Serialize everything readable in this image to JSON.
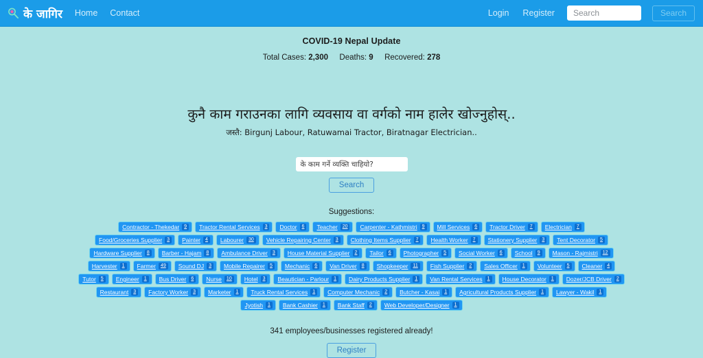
{
  "navbar": {
    "brand_icon": "magnifier-icon",
    "brand_text": "के जागिर",
    "links": [
      {
        "label": "Home"
      },
      {
        "label": "Contact"
      }
    ],
    "login_label": "Login",
    "register_label": "Register",
    "search_placeholder": "Search",
    "search_value": "",
    "search_button_label": "Search",
    "bg_color": "#1b9ce8"
  },
  "covid": {
    "title": "COVID-19 Nepal Update",
    "total_cases_label": "Total Cases:",
    "total_cases_value": "2,300",
    "deaths_label": "Deaths:",
    "deaths_value": "9",
    "recovered_label": "Recovered:",
    "recovered_value": "278"
  },
  "hero": {
    "heading": "कुनै काम गराउनका लागि व्यवसाय वा वर्गको नाम हालेर खोज्नुहोस्..",
    "subheading": "जस्तै: Birgunj Labour, Ratuwamai Tractor, Biratnagar Electrician.."
  },
  "search": {
    "placeholder": "के काम गर्ने व्यक्ति चाहियो?",
    "value": "",
    "button_label": "Search"
  },
  "suggestions": {
    "label": "Suggestions:",
    "tags": [
      {
        "label": "Contractor - Thekedar",
        "count": "9"
      },
      {
        "label": "Tractor Rental Services",
        "count": "3"
      },
      {
        "label": "Doctor",
        "count": "6"
      },
      {
        "label": "Teacher",
        "count": "20"
      },
      {
        "label": "Carpenter - Kathmistri",
        "count": "9"
      },
      {
        "label": "Mill Services",
        "count": "6"
      },
      {
        "label": "Tractor Driver",
        "count": "7"
      },
      {
        "label": "Electrician",
        "count": "7"
      },
      {
        "label": "Food/Groceries Supplier",
        "count": "3"
      },
      {
        "label": "Painter",
        "count": "4"
      },
      {
        "label": "Labourer",
        "count": "30"
      },
      {
        "label": "Vehicle Repairing Center",
        "count": "3"
      },
      {
        "label": "Clothing Items Supplier",
        "count": "7"
      },
      {
        "label": "Health Worker",
        "count": "7"
      },
      {
        "label": "Stationery Supplier",
        "count": "3"
      },
      {
        "label": "Tent Decorator",
        "count": "5"
      },
      {
        "label": "Hardware Supplier",
        "count": "8"
      },
      {
        "label": "Barber - Hajam",
        "count": "8"
      },
      {
        "label": "Ambulance Driver",
        "count": "3"
      },
      {
        "label": "House Material Supplier",
        "count": "2"
      },
      {
        "label": "Tailor",
        "count": "6"
      },
      {
        "label": "Photographer",
        "count": "5"
      },
      {
        "label": "Social Worker",
        "count": "6"
      },
      {
        "label": "School",
        "count": "9"
      },
      {
        "label": "Mason - Rajmistri",
        "count": "12"
      },
      {
        "label": "Harvester",
        "count": "1"
      },
      {
        "label": "Farmer",
        "count": "49"
      },
      {
        "label": "Sound DJ",
        "count": "3"
      },
      {
        "label": "Mobile Repairer",
        "count": "5"
      },
      {
        "label": "Mechanic",
        "count": "6"
      },
      {
        "label": "Van Driver",
        "count": "8"
      },
      {
        "label": "Shopkeeper",
        "count": "11"
      },
      {
        "label": "Fish Supplier",
        "count": "2"
      },
      {
        "label": "Sales Officer",
        "count": "1"
      },
      {
        "label": "Volunteer",
        "count": "5"
      },
      {
        "label": "Cleaner",
        "count": "4"
      },
      {
        "label": "Tutor",
        "count": "5"
      },
      {
        "label": "Engineer",
        "count": "1"
      },
      {
        "label": "Bus Driver",
        "count": "6"
      },
      {
        "label": "Nurse",
        "count": "10"
      },
      {
        "label": "Hotel",
        "count": "3"
      },
      {
        "label": "Beautician - Parlour",
        "count": "1"
      },
      {
        "label": "Dairy Products Supplier",
        "count": "1"
      },
      {
        "label": "Van Rental Services",
        "count": "1"
      },
      {
        "label": "House Decorator",
        "count": "1"
      },
      {
        "label": "Dozer/JCB Driver",
        "count": "2"
      },
      {
        "label": "Restaurant",
        "count": "3"
      },
      {
        "label": "Factory Worker",
        "count": "3"
      },
      {
        "label": "Marketer",
        "count": "1"
      },
      {
        "label": "Truck Rental Services",
        "count": "1"
      },
      {
        "label": "Computer Mechanic",
        "count": "2"
      },
      {
        "label": "Butcher - Kasai",
        "count": "1"
      },
      {
        "label": "Agricultural Products Supplier",
        "count": "1"
      },
      {
        "label": "Lawyer - Wakil",
        "count": "1"
      },
      {
        "label": "Jyotish",
        "count": "1"
      },
      {
        "label": "Bank Cashier",
        "count": "1"
      },
      {
        "label": "Bank Staff",
        "count": "2"
      },
      {
        "label": "Web Developer/Designer",
        "count": "1"
      }
    ]
  },
  "footer": {
    "registered_text": "341 employees/businesses registered already!",
    "register_button_label": "Register"
  }
}
